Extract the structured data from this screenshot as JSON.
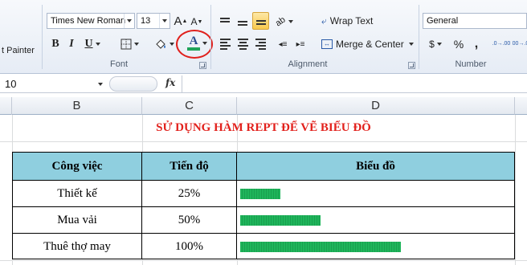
{
  "ribbon": {
    "clipboard": {
      "format_painter_label": "t Painter"
    },
    "font": {
      "group_label": "Font",
      "font_name": "Times New Roman",
      "font_size": "13",
      "bold": "B",
      "italic": "I",
      "underline": "U",
      "grow_font": "A",
      "shrink_font": "A",
      "font_color_letter": "A",
      "font_color": "#1fa45a",
      "highlight_circle_color": "#e0201c"
    },
    "alignment": {
      "group_label": "Alignment",
      "wrap_text": "Wrap Text",
      "merge_center": "Merge & Center"
    },
    "number": {
      "group_label": "Number",
      "format": "General",
      "currency": "$",
      "percent": "%",
      "comma": ",",
      "increase_decimal": ".0→.00",
      "decrease_decimal": ".00→.0"
    }
  },
  "formula_bar": {
    "name_box": "10",
    "fx": "fx",
    "formula": ""
  },
  "sheet": {
    "columns": [
      "B",
      "C",
      "D"
    ],
    "title": "SỬ DỤNG HÀM REPT ĐỂ VẼ BIỂU ĐỒ",
    "title_color": "#e2211c",
    "header_fill": "#8fcfdf",
    "bar_color": "#1fb55b",
    "table": {
      "headers": [
        "Công việc",
        "Tiến độ",
        "Biểu đồ"
      ],
      "rows": [
        {
          "task": "Thiết kế",
          "progress": "25%",
          "value": 0.25
        },
        {
          "task": "Mua vải",
          "progress": "50%",
          "value": 0.5
        },
        {
          "task": "Thuê thợ may",
          "progress": "100%",
          "value": 1.0
        }
      ]
    }
  }
}
